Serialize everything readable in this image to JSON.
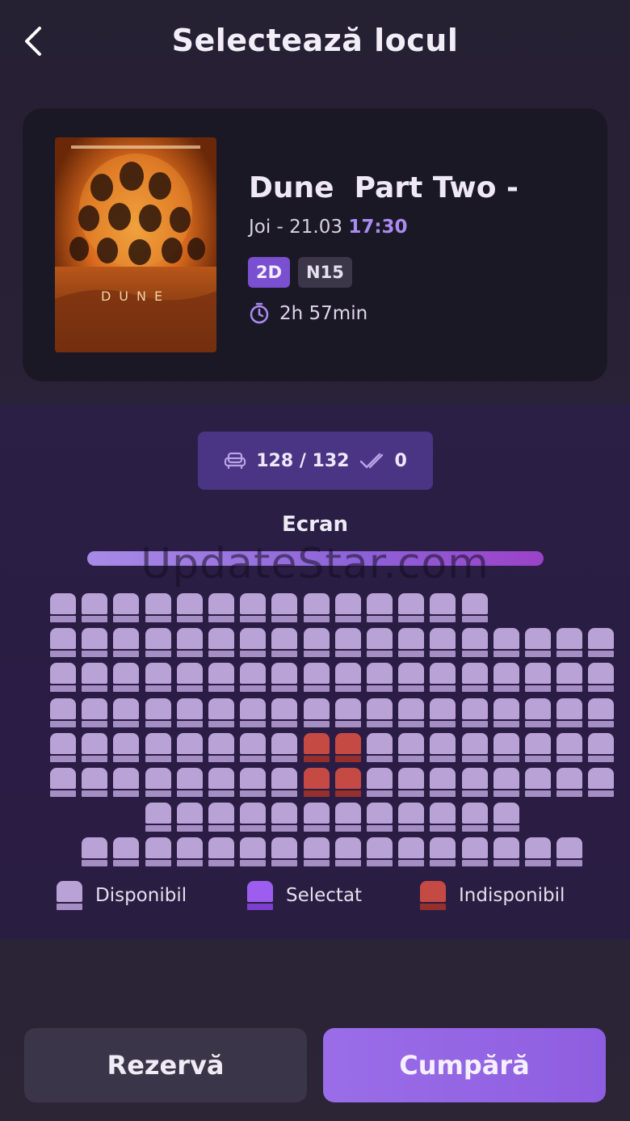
{
  "header": {
    "title": "Selectează locul",
    "back_icon": "chevron-left-icon"
  },
  "movie": {
    "title": "Dune  Part Two -",
    "day": "Joi - 21.03 ",
    "time": "17:30",
    "format": "2D",
    "rating": "N15",
    "duration": "2h 57min",
    "duration_icon": "timer-icon",
    "poster_icon": "movie-poster-image"
  },
  "seats": {
    "available_count": "128 / 132",
    "selected_count": "0",
    "seat_icon": "seat-icon",
    "check_icon": "check-icon",
    "screen_label": "Ecran",
    "watermark": "UpdateStar.com",
    "rows": [
      {
        "offset": 0,
        "count": 14,
        "unavailable": []
      },
      {
        "offset": 0,
        "count": 18,
        "unavailable": []
      },
      {
        "offset": 0,
        "count": 18,
        "unavailable": []
      },
      {
        "offset": 0,
        "count": 18,
        "unavailable": []
      },
      {
        "offset": 0,
        "count": 18,
        "unavailable": [
          8,
          9
        ]
      },
      {
        "offset": 0,
        "count": 18,
        "unavailable": [
          8,
          9
        ]
      },
      {
        "offset": 3,
        "count": 12,
        "unavailable": []
      },
      {
        "offset": 1,
        "count": 16,
        "unavailable": []
      }
    ],
    "colors": {
      "available": "#b9a3d6",
      "selected": "#9d5ef0",
      "unavailable": "#c64a44"
    }
  },
  "legend": {
    "available": "Disponibil",
    "selected": "Selectat",
    "unavailable": "Indisponibil"
  },
  "actions": {
    "reserve": "Rezervă",
    "buy": "Cumpără"
  },
  "colors": {
    "accent": "#9a6de8",
    "background": "#262033"
  }
}
